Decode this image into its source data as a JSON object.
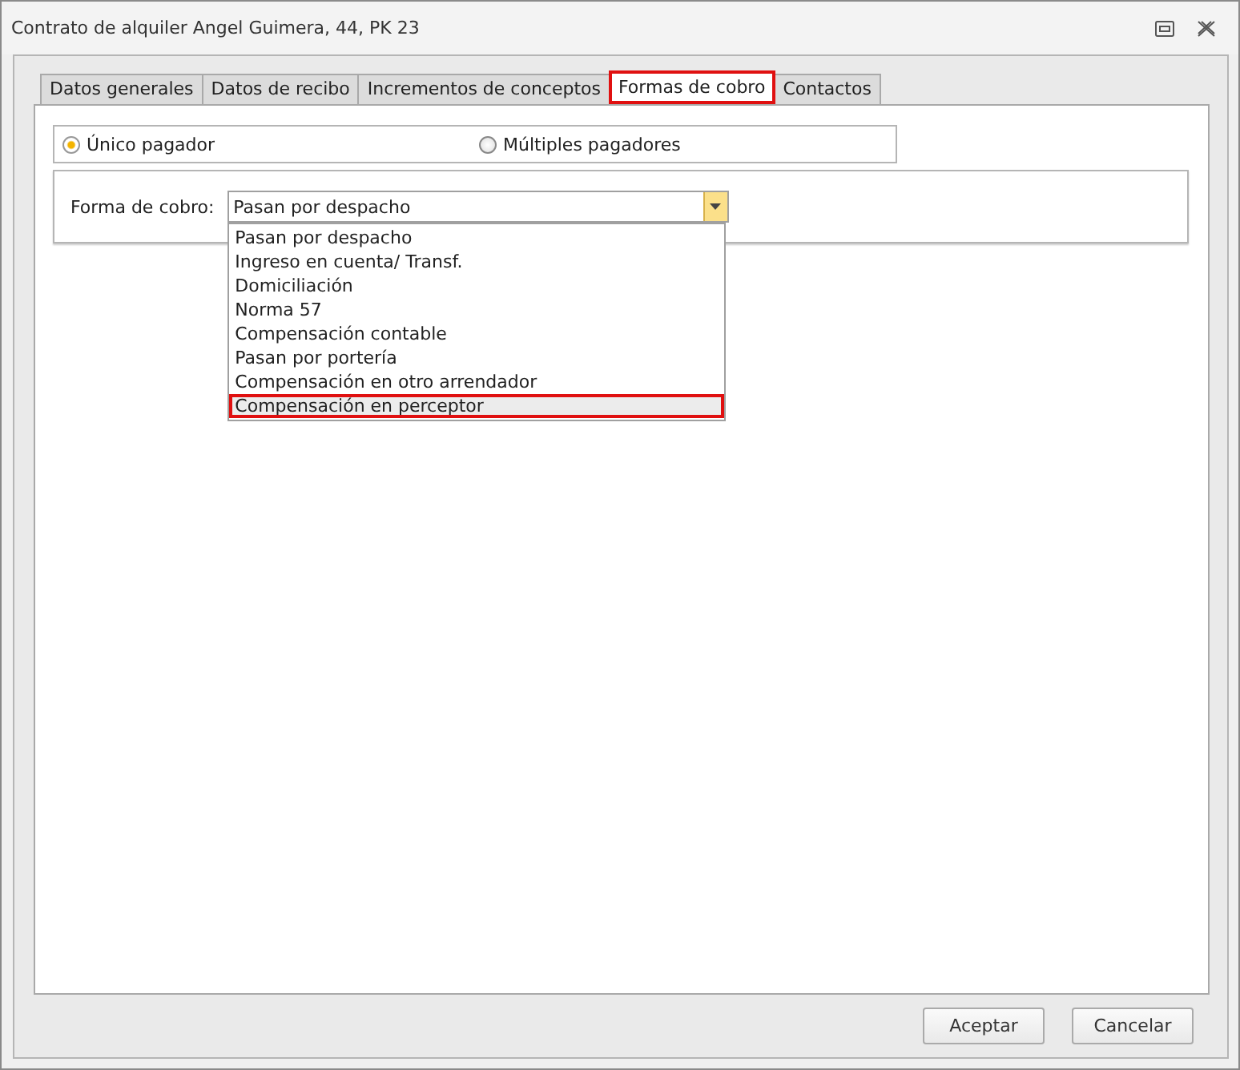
{
  "window": {
    "title": "Contrato de alquiler Angel Guimera, 44, PK 23"
  },
  "tabs": [
    {
      "label": "Datos generales",
      "selected": false,
      "highlighted": false
    },
    {
      "label": "Datos de recibo",
      "selected": false,
      "highlighted": false
    },
    {
      "label": "Incrementos de conceptos",
      "selected": false,
      "highlighted": false
    },
    {
      "label": "Formas de cobro",
      "selected": true,
      "highlighted": true
    },
    {
      "label": "Contactos",
      "selected": false,
      "highlighted": false
    }
  ],
  "payer_options": [
    {
      "label": "Único pagador",
      "selected": true
    },
    {
      "label": "Múltiples pagadores",
      "selected": false
    }
  ],
  "payment_method": {
    "label": "Forma de cobro:",
    "value": "Pasan por despacho",
    "expanded": true,
    "options": [
      {
        "label": "Pasan por despacho",
        "hovered": false,
        "highlighted": false
      },
      {
        "label": "Ingreso en cuenta/ Transf.",
        "hovered": false,
        "highlighted": false
      },
      {
        "label": "Domiciliación",
        "hovered": false,
        "highlighted": false
      },
      {
        "label": "Norma 57",
        "hovered": false,
        "highlighted": false
      },
      {
        "label": "Compensación contable",
        "hovered": false,
        "highlighted": false
      },
      {
        "label": "Pasan por portería",
        "hovered": false,
        "highlighted": false
      },
      {
        "label": "Compensación en otro arrendador",
        "hovered": false,
        "highlighted": false
      },
      {
        "label": "Compensación en perceptor",
        "hovered": true,
        "highlighted": true
      }
    ]
  },
  "buttons": [
    "Aceptar",
    "Cancelar"
  ]
}
